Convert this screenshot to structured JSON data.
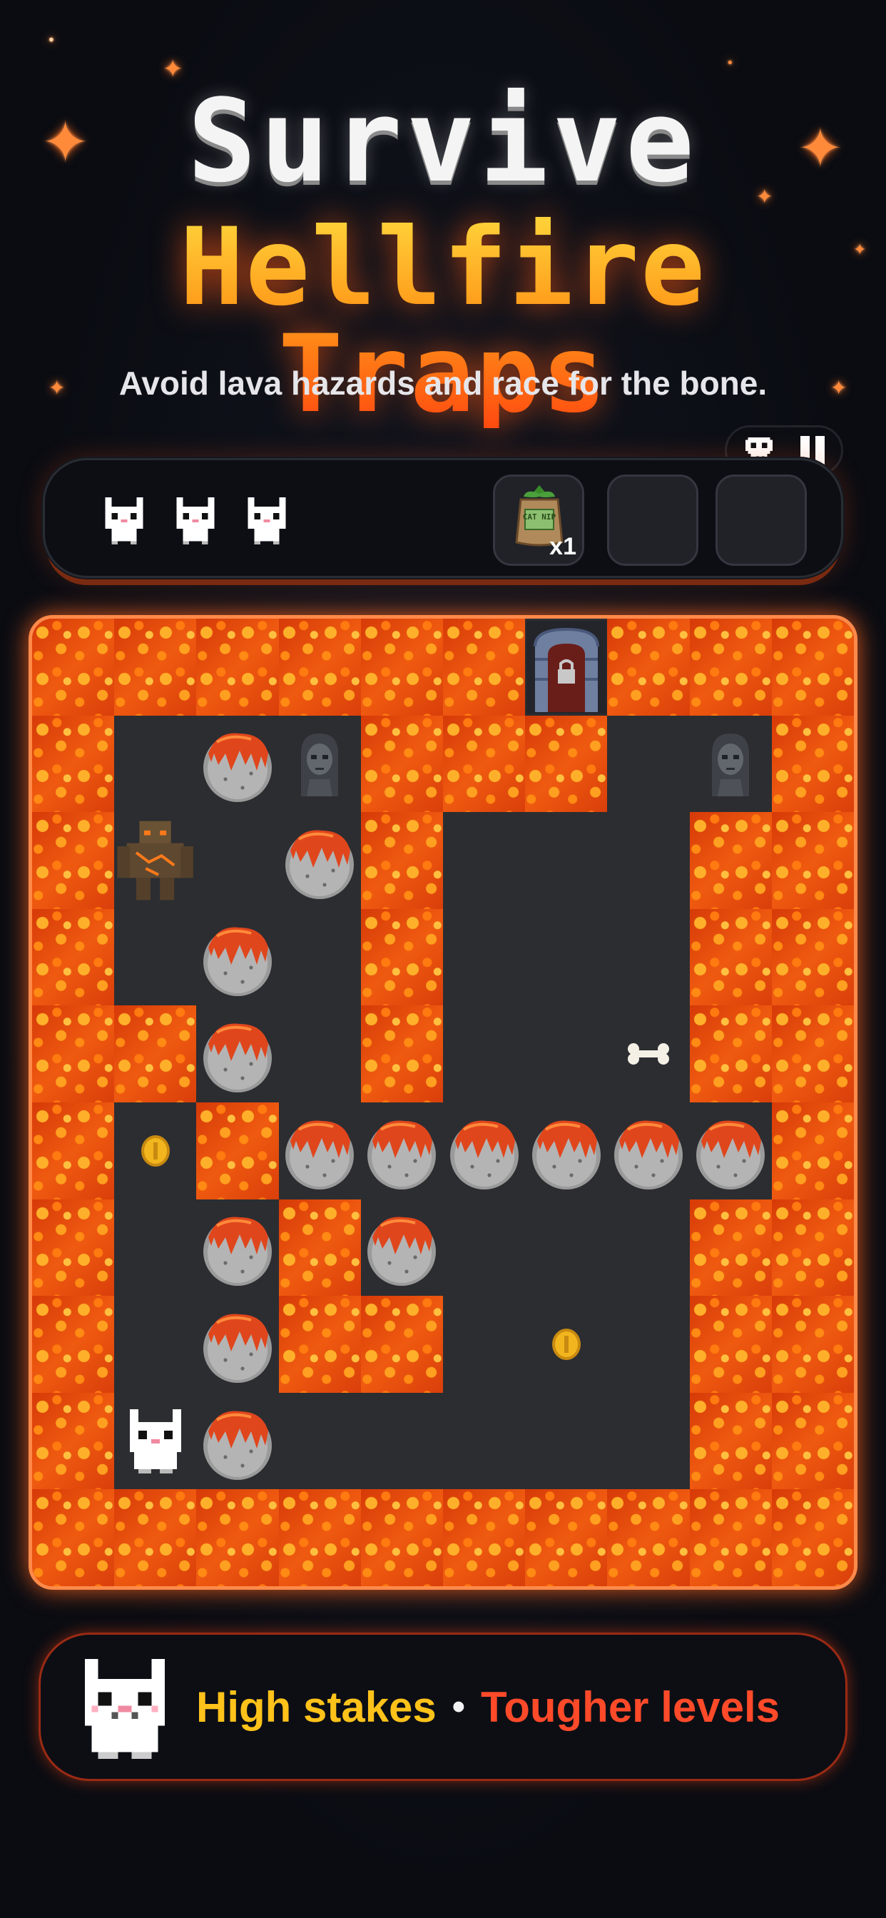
{
  "title": {
    "line1": "Survive",
    "line2": "Hellfire Traps",
    "subtitle": "Avoid lava hazards and race for the bone."
  },
  "hud": {
    "lives": 3,
    "items": [
      {
        "icon": "catnip-bag-icon",
        "label": "CAT NIP",
        "count": "x1"
      },
      {
        "icon": "empty-slot",
        "label": "",
        "count": ""
      },
      {
        "icon": "empty-slot",
        "label": "",
        "count": ""
      }
    ],
    "controls": [
      {
        "icon": "skull-icon"
      },
      {
        "icon": "pause-icon"
      }
    ]
  },
  "board": {
    "columns": 10,
    "rows": 10,
    "legend": {
      "L": "lava",
      ".": "floor",
      "R": "lava-boulder",
      "G": "ghost-girl",
      "M": "lava-golem",
      "B": "bone",
      "C": "coin",
      "P": "player-cat",
      "D": "locked-door"
    },
    "grid": [
      "LLLLLLDLLL",
      "L.RGLLL.GL",
      "LM.RL...L",
      "L.R.L...L",
      "LLR.L..BL",
      "LCLRRRRRRL",
      "L.RLR...L",
      "L.RLL.C.L",
      "LPR.....L",
      "LLLLLLLLLL"
    ]
  },
  "banner": {
    "text_left": "High stakes",
    "separator": "•",
    "text_right": "Tougher levels",
    "colors": {
      "left": "#ffc21a",
      "right": "#ff4a2a"
    }
  },
  "colors": {
    "lava": "#e4480c",
    "floor": "#2c2d31",
    "frame_glow": "#ff8a4a",
    "background": "#0a0c12"
  }
}
